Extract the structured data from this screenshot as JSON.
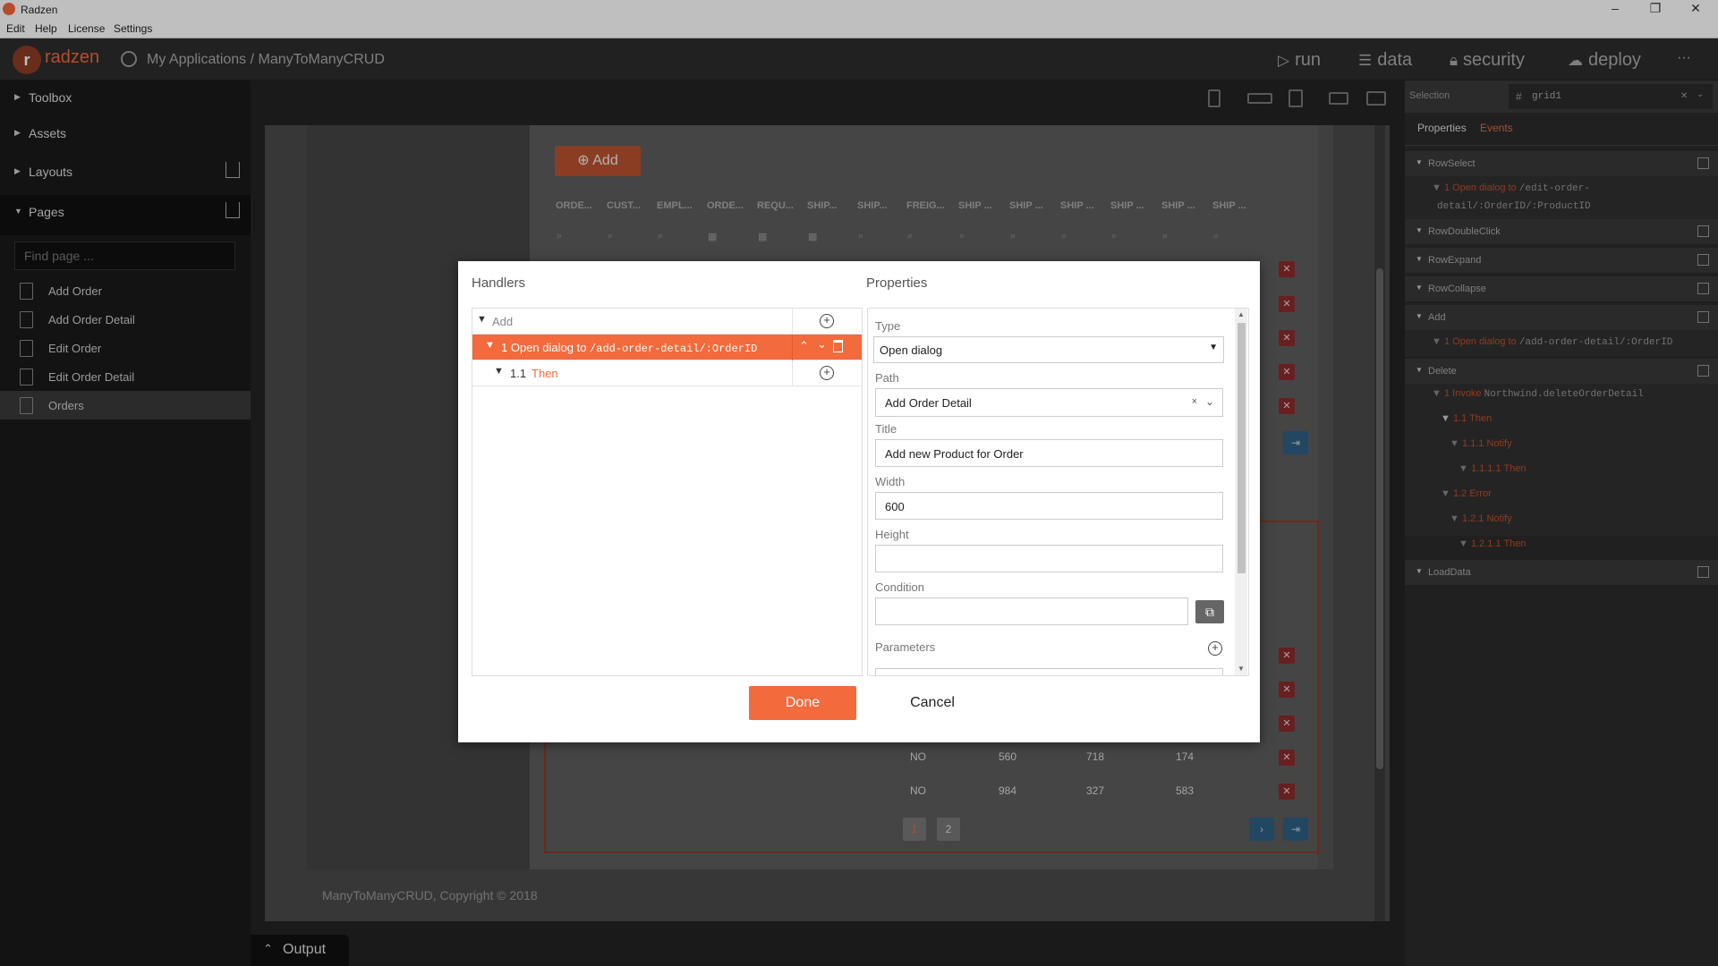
{
  "window": {
    "title": "Radzen"
  },
  "menu": [
    "Edit",
    "Help",
    "License",
    "Settings"
  ],
  "appbar": {
    "brand": "radzen",
    "breadcrumb": "My Applications / ManyToManyCRUD",
    "nav": {
      "run": "run",
      "data": "data",
      "security": "security",
      "deploy": "deploy",
      "more": "···"
    }
  },
  "sidebar": {
    "toolbox": "Toolbox",
    "assets": "Assets",
    "layouts": "Layouts",
    "pages": "Pages",
    "find_placeholder": "Find page ...",
    "page_items": [
      "Add Order",
      "Add Order Detail",
      "Edit Order",
      "Edit Order Detail",
      "Orders"
    ]
  },
  "canvas": {
    "add_button": "Add",
    "columns": [
      "ORDE...",
      "CUST...",
      "EMPL...",
      "ORDE...",
      "REQU...",
      "SHIP...",
      "SHIP...",
      "FREIG...",
      "SHIP ...",
      "SHIP ...",
      "SHIP ...",
      "SHIP ...",
      "SHIP ...",
      "SHIP ..."
    ],
    "rows": [
      {
        "c1": "NO",
        "c2": "560",
        "c3": "718",
        "c4": "174"
      },
      {
        "c1": "NO",
        "c2": "984",
        "c3": "327",
        "c4": "583"
      }
    ],
    "pages": [
      "1",
      "2"
    ],
    "footer": "ManyToManyCRUD, Copyright © 2018",
    "output_tab": "Output"
  },
  "right_panel": {
    "selection_label": "Selection",
    "selection_value": "grid1",
    "tabs": {
      "properties": "Properties",
      "events": "Events"
    },
    "events": {
      "rowselect": "RowSelect",
      "rowselect_1_num": "1",
      "rowselect_1_action": "Open dialog to",
      "rowselect_1_path_a": "/edit-order-",
      "rowselect_1_path_b": "detail/:OrderID/:ProductID",
      "rowdoubleclick": "RowDoubleClick",
      "rowexpand": "RowExpand",
      "rowcollapse": "RowCollapse",
      "add": "Add",
      "add_1_num": "1",
      "add_1_action": "Open dialog to",
      "add_1_path": "/add-order-detail/:OrderID",
      "delete": "Delete",
      "delete_1_num": "1",
      "delete_1_action": "Invoke",
      "delete_1_method": "Northwind.deleteOrderDetail",
      "d_1_1_num": "1.1",
      "d_1_1": "Then",
      "d_1_1_1_num": "1.1.1",
      "d_1_1_1": "Notify",
      "d_1_1_1_1_num": "1.1.1.1",
      "d_1_1_1_1": "Then",
      "d_1_2_num": "1.2",
      "d_1_2": "Error",
      "d_1_2_1_num": "1.2.1",
      "d_1_2_1": "Notify",
      "d_1_2_1_1_num": "1.2.1.1",
      "d_1_2_1_1": "Then",
      "loaddata": "LoadData"
    }
  },
  "dialog": {
    "handlers_title": "Handlers",
    "properties_title": "Properties",
    "handler_root": "Add",
    "handler_1_num": "1",
    "handler_1_text": "Open dialog to",
    "handler_1_path": "/add-order-detail/:OrderID",
    "handler_1_1_num": "1.1",
    "handler_1_1_text": "Then",
    "type_label": "Type",
    "type_value": "Open dialog",
    "path_label": "Path",
    "path_value": "Add Order Detail",
    "title_label": "Title",
    "title_value": "Add new Product for Order",
    "width_label": "Width",
    "width_value": "600",
    "height_label": "Height",
    "height_value": "",
    "condition_label": "Condition",
    "condition_value": "",
    "parameters_label": "Parameters",
    "done": "Done",
    "cancel": "Cancel"
  }
}
